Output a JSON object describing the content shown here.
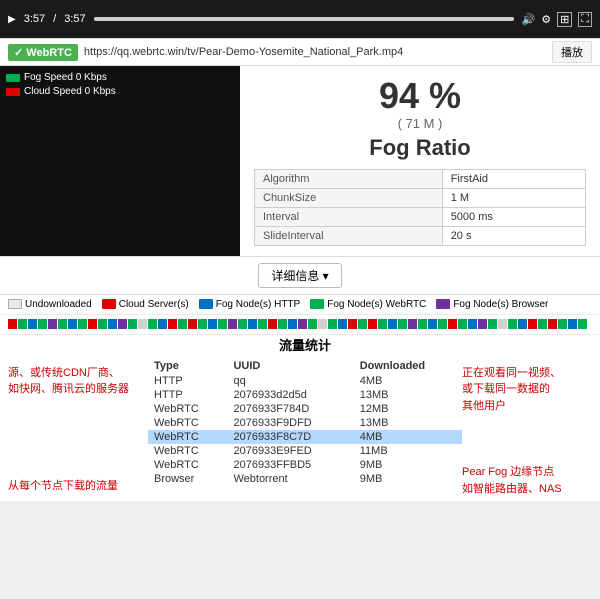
{
  "player": {
    "time_current": "3:57",
    "time_total": "3:57",
    "progress_percent": 100
  },
  "urlbar": {
    "badge_label": "✓ WebRTC",
    "url": "https://qq.webrtc.win/tv/Pear-Demo-Yosemite_National_Park.mp4",
    "play_button": "播放"
  },
  "stats": {
    "percentage": "94 %",
    "size": "( 71 M )",
    "title": "Fog Ratio",
    "table": [
      {
        "key": "Algorithm",
        "value": "FirstAid"
      },
      {
        "key": "ChunkSize",
        "value": "1 M"
      },
      {
        "key": "Interval",
        "value": "5000 ms"
      },
      {
        "key": "SlideInterval",
        "value": "20 s"
      }
    ]
  },
  "legend": {
    "fog_speed": "Fog Speed 0 Kbps",
    "cloud_speed": "Cloud Speed 0 Kbps"
  },
  "details_button": "详细信息 ▾",
  "legend_bar": {
    "undownloaded": "Undownloaded",
    "cloud_server": "Cloud Server(s)",
    "fog_http": "Fog Node(s) HTTP",
    "fog_webrtc": "Fog Node(s) WebRTC",
    "fog_browser": "Fog Node(s) Browser"
  },
  "flow_stats": {
    "title": "流量统计",
    "headers": [
      "Type",
      "UUID",
      "Downloaded"
    ],
    "rows": [
      {
        "type": "HTTP",
        "uuid": "qq",
        "downloaded": "4MB",
        "highlight": false
      },
      {
        "type": "HTTP",
        "uuid": "2076933d2d5d",
        "downloaded": "13MB",
        "highlight": false
      },
      {
        "type": "WebRTC",
        "uuid": "2076933F784D",
        "downloaded": "12MB",
        "highlight": false
      },
      {
        "type": "WebRTC",
        "uuid": "2076933F9DFD",
        "downloaded": "13MB",
        "highlight": false
      },
      {
        "type": "WebRTC",
        "uuid": "2076933F8C7D",
        "downloaded": "4MB",
        "highlight": true
      },
      {
        "type": "WebRTC",
        "uuid": "2076933E9FED",
        "downloaded": "11MB",
        "highlight": false
      },
      {
        "type": "WebRTC",
        "uuid": "2076933FFBD5",
        "downloaded": "9MB",
        "highlight": false
      },
      {
        "type": "Browser",
        "uuid": "Webtorrent",
        "downloaded": "9MB",
        "highlight": false
      }
    ]
  },
  "annotations": {
    "left_top": "源、或传统CDN厂商、\n如快网、腾讯云的服务器",
    "left_bottom": "从每个节点下载的流量",
    "right_top": "正在观看同一视频、\n或下载同一数据的\n其他用户",
    "right_bottom": "Pear Fog 边缘节点\n如智能路由器、NAS"
  },
  "colors": {
    "fog_green": "#00b050",
    "cloud_red": "#e00000",
    "cloud_server_red": "#e00000",
    "fog_http_blue": "#0070c0",
    "fog_webrtc_green": "#00b050",
    "fog_browser_purple": "#7030a0",
    "undownloaded_gray": "#d0d0d0",
    "highlight_blue": "#b3d9ff"
  }
}
